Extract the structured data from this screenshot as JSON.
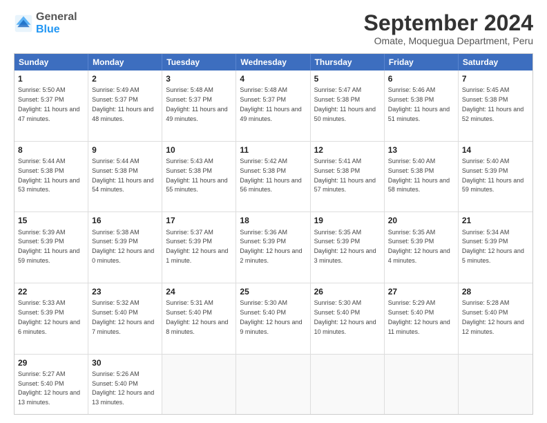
{
  "logo": {
    "general": "General",
    "blue": "Blue"
  },
  "title": "September 2024",
  "subtitle": "Omate, Moquegua Department, Peru",
  "weekdays": [
    "Sunday",
    "Monday",
    "Tuesday",
    "Wednesday",
    "Thursday",
    "Friday",
    "Saturday"
  ],
  "weeks": [
    [
      {
        "day": "1",
        "sunrise": "Sunrise: 5:50 AM",
        "sunset": "Sunset: 5:37 PM",
        "daylight": "Daylight: 11 hours and 47 minutes."
      },
      {
        "day": "2",
        "sunrise": "Sunrise: 5:49 AM",
        "sunset": "Sunset: 5:37 PM",
        "daylight": "Daylight: 11 hours and 48 minutes."
      },
      {
        "day": "3",
        "sunrise": "Sunrise: 5:48 AM",
        "sunset": "Sunset: 5:37 PM",
        "daylight": "Daylight: 11 hours and 49 minutes."
      },
      {
        "day": "4",
        "sunrise": "Sunrise: 5:48 AM",
        "sunset": "Sunset: 5:37 PM",
        "daylight": "Daylight: 11 hours and 49 minutes."
      },
      {
        "day": "5",
        "sunrise": "Sunrise: 5:47 AM",
        "sunset": "Sunset: 5:38 PM",
        "daylight": "Daylight: 11 hours and 50 minutes."
      },
      {
        "day": "6",
        "sunrise": "Sunrise: 5:46 AM",
        "sunset": "Sunset: 5:38 PM",
        "daylight": "Daylight: 11 hours and 51 minutes."
      },
      {
        "day": "7",
        "sunrise": "Sunrise: 5:45 AM",
        "sunset": "Sunset: 5:38 PM",
        "daylight": "Daylight: 11 hours and 52 minutes."
      }
    ],
    [
      {
        "day": "8",
        "sunrise": "Sunrise: 5:44 AM",
        "sunset": "Sunset: 5:38 PM",
        "daylight": "Daylight: 11 hours and 53 minutes."
      },
      {
        "day": "9",
        "sunrise": "Sunrise: 5:44 AM",
        "sunset": "Sunset: 5:38 PM",
        "daylight": "Daylight: 11 hours and 54 minutes."
      },
      {
        "day": "10",
        "sunrise": "Sunrise: 5:43 AM",
        "sunset": "Sunset: 5:38 PM",
        "daylight": "Daylight: 11 hours and 55 minutes."
      },
      {
        "day": "11",
        "sunrise": "Sunrise: 5:42 AM",
        "sunset": "Sunset: 5:38 PM",
        "daylight": "Daylight: 11 hours and 56 minutes."
      },
      {
        "day": "12",
        "sunrise": "Sunrise: 5:41 AM",
        "sunset": "Sunset: 5:38 PM",
        "daylight": "Daylight: 11 hours and 57 minutes."
      },
      {
        "day": "13",
        "sunrise": "Sunrise: 5:40 AM",
        "sunset": "Sunset: 5:38 PM",
        "daylight": "Daylight: 11 hours and 58 minutes."
      },
      {
        "day": "14",
        "sunrise": "Sunrise: 5:40 AM",
        "sunset": "Sunset: 5:39 PM",
        "daylight": "Daylight: 11 hours and 59 minutes."
      }
    ],
    [
      {
        "day": "15",
        "sunrise": "Sunrise: 5:39 AM",
        "sunset": "Sunset: 5:39 PM",
        "daylight": "Daylight: 11 hours and 59 minutes."
      },
      {
        "day": "16",
        "sunrise": "Sunrise: 5:38 AM",
        "sunset": "Sunset: 5:39 PM",
        "daylight": "Daylight: 12 hours and 0 minutes."
      },
      {
        "day": "17",
        "sunrise": "Sunrise: 5:37 AM",
        "sunset": "Sunset: 5:39 PM",
        "daylight": "Daylight: 12 hours and 1 minute."
      },
      {
        "day": "18",
        "sunrise": "Sunrise: 5:36 AM",
        "sunset": "Sunset: 5:39 PM",
        "daylight": "Daylight: 12 hours and 2 minutes."
      },
      {
        "day": "19",
        "sunrise": "Sunrise: 5:35 AM",
        "sunset": "Sunset: 5:39 PM",
        "daylight": "Daylight: 12 hours and 3 minutes."
      },
      {
        "day": "20",
        "sunrise": "Sunrise: 5:35 AM",
        "sunset": "Sunset: 5:39 PM",
        "daylight": "Daylight: 12 hours and 4 minutes."
      },
      {
        "day": "21",
        "sunrise": "Sunrise: 5:34 AM",
        "sunset": "Sunset: 5:39 PM",
        "daylight": "Daylight: 12 hours and 5 minutes."
      }
    ],
    [
      {
        "day": "22",
        "sunrise": "Sunrise: 5:33 AM",
        "sunset": "Sunset: 5:39 PM",
        "daylight": "Daylight: 12 hours and 6 minutes."
      },
      {
        "day": "23",
        "sunrise": "Sunrise: 5:32 AM",
        "sunset": "Sunset: 5:40 PM",
        "daylight": "Daylight: 12 hours and 7 minutes."
      },
      {
        "day": "24",
        "sunrise": "Sunrise: 5:31 AM",
        "sunset": "Sunset: 5:40 PM",
        "daylight": "Daylight: 12 hours and 8 minutes."
      },
      {
        "day": "25",
        "sunrise": "Sunrise: 5:30 AM",
        "sunset": "Sunset: 5:40 PM",
        "daylight": "Daylight: 12 hours and 9 minutes."
      },
      {
        "day": "26",
        "sunrise": "Sunrise: 5:30 AM",
        "sunset": "Sunset: 5:40 PM",
        "daylight": "Daylight: 12 hours and 10 minutes."
      },
      {
        "day": "27",
        "sunrise": "Sunrise: 5:29 AM",
        "sunset": "Sunset: 5:40 PM",
        "daylight": "Daylight: 12 hours and 11 minutes."
      },
      {
        "day": "28",
        "sunrise": "Sunrise: 5:28 AM",
        "sunset": "Sunset: 5:40 PM",
        "daylight": "Daylight: 12 hours and 12 minutes."
      }
    ],
    [
      {
        "day": "29",
        "sunrise": "Sunrise: 5:27 AM",
        "sunset": "Sunset: 5:40 PM",
        "daylight": "Daylight: 12 hours and 13 minutes."
      },
      {
        "day": "30",
        "sunrise": "Sunrise: 5:26 AM",
        "sunset": "Sunset: 5:40 PM",
        "daylight": "Daylight: 12 hours and 13 minutes."
      },
      null,
      null,
      null,
      null,
      null
    ]
  ]
}
